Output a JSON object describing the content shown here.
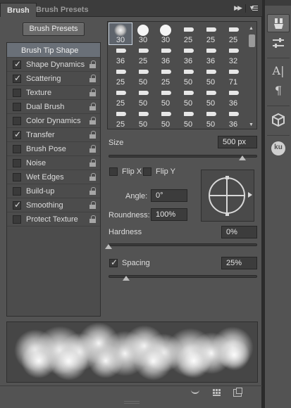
{
  "tabs": {
    "brush": "Brush",
    "brush_presets": "Brush Presets"
  },
  "presets_button": "Brush Presets",
  "options": [
    {
      "label": "Brush Tip Shape",
      "checked": null,
      "locked": false,
      "header": true
    },
    {
      "label": "Shape Dynamics",
      "checked": true,
      "locked": true
    },
    {
      "label": "Scattering",
      "checked": true,
      "locked": true
    },
    {
      "label": "Texture",
      "checked": false,
      "locked": true
    },
    {
      "label": "Dual Brush",
      "checked": false,
      "locked": true
    },
    {
      "label": "Color Dynamics",
      "checked": false,
      "locked": true
    },
    {
      "label": "Transfer",
      "checked": true,
      "locked": true
    },
    {
      "label": "Brush Pose",
      "checked": false,
      "locked": true
    },
    {
      "label": "Noise",
      "checked": false,
      "locked": true
    },
    {
      "label": "Wet Edges",
      "checked": false,
      "locked": true
    },
    {
      "label": "Build-up",
      "checked": false,
      "locked": true
    },
    {
      "label": "Smoothing",
      "checked": true,
      "locked": true
    },
    {
      "label": "Protect Texture",
      "checked": false,
      "locked": true
    }
  ],
  "brush_sizes": [
    "30",
    "30",
    "30",
    "25",
    "25",
    "25",
    "36",
    "25",
    "36",
    "36",
    "36",
    "32",
    "25",
    "50",
    "25",
    "50",
    "50",
    "71",
    "25",
    "50",
    "50",
    "50",
    "50",
    "36",
    "25",
    "50",
    "50",
    "50",
    "50",
    "36"
  ],
  "size": {
    "label": "Size",
    "value": "500 px",
    "slider": 0.9
  },
  "flip_x": {
    "label": "Flip X",
    "checked": false
  },
  "flip_y": {
    "label": "Flip Y",
    "checked": false
  },
  "angle": {
    "label": "Angle:",
    "value": "0°"
  },
  "roundness": {
    "label": "Roundness:",
    "value": "100%"
  },
  "hardness": {
    "label": "Hardness",
    "value": "0%",
    "slider": 0.0
  },
  "spacing": {
    "label": "Spacing",
    "checked": true,
    "value": "25%",
    "slider": 0.12
  },
  "footer_icons": [
    "eye-brush-icon",
    "grid-icon",
    "new-preset-icon"
  ],
  "dock": {
    "type_tool_label": "A|",
    "paragraph_label": "¶",
    "ku_label": "ku"
  }
}
